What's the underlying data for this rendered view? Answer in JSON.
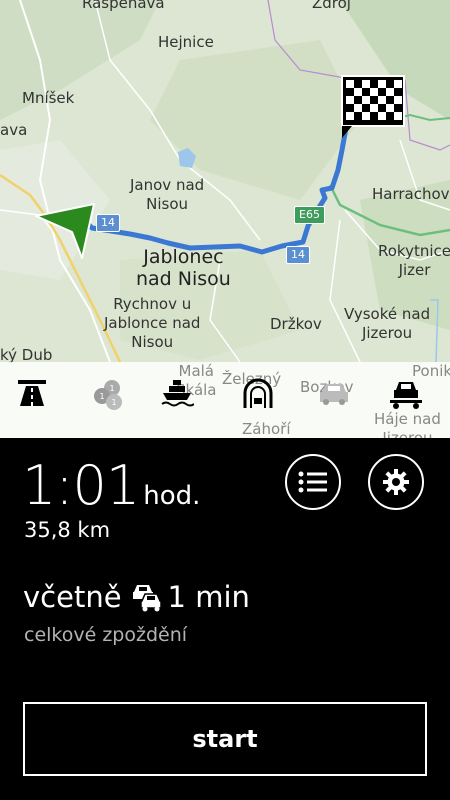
{
  "map": {
    "places": {
      "raspenava": "Raspenava",
      "zdroj": "Zdroj",
      "hejnice": "Hejnice",
      "mnisek": "Mníšek",
      "ava": "ava",
      "janov": "Janov nad\nNisou",
      "harrachov": "Harrachov",
      "jablonec": "Jablonec\nnad Nisou",
      "rokytnice": "Rokytnice\nJizer",
      "rychnov": "Rychnov u\nJablonce nad\nNisou",
      "vysoke": "Vysoké nad\nJizerou",
      "drzkov": "Držkov",
      "kydub": "ký Dub",
      "mala_skala": "Malá\nSkála",
      "zelezny": "Železný",
      "zahori": "Záhoří",
      "bozkov": "Bozkov",
      "ponikla": "Ponikl",
      "haje": "Háje nad\nJizerou"
    },
    "shields": {
      "road14_a": "14",
      "road14_b": "14",
      "e65": "E65"
    },
    "colors": {
      "route": "#3a78d4",
      "position_arrow": "#2a8a1e",
      "destination_flag": "#000000"
    }
  },
  "avoid_options": [
    {
      "icon": "motorway-icon"
    },
    {
      "icon": "toll-coins-icon"
    },
    {
      "icon": "ferry-icon"
    },
    {
      "icon": "tunnel-icon"
    },
    {
      "icon": "traffic-car-icon"
    },
    {
      "icon": "car-train-icon"
    }
  ],
  "summary": {
    "duration": "1:01",
    "duration_unit": "hod.",
    "distance": "35,8 km",
    "delay_prefix": "včetně",
    "delay_value": "1 min",
    "delay_label": "celkové zpoždění"
  },
  "start_label": "start"
}
